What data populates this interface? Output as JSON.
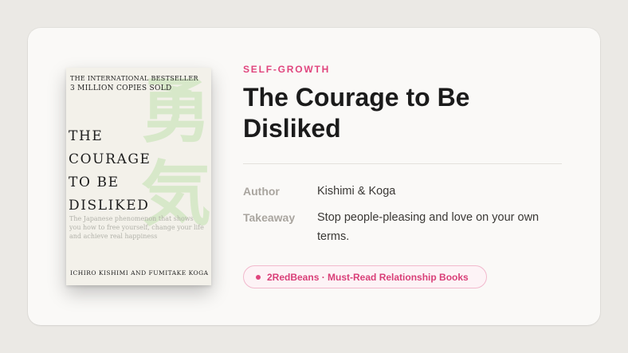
{
  "book": {
    "cover": {
      "top_line_1": "THE INTERNATIONAL BESTSELLER",
      "top_line_2": "3 MILLION COPIES SOLD",
      "kanji": "勇気",
      "title_lines": [
        "THE",
        "COURAGE",
        "TO BE",
        "DISLIKED"
      ],
      "blurb": "The Japanese phenomenon that shows you how to free yourself, change your life and achieve real happiness",
      "authors": "ICHIRO KISHIMI AND FUMITAKE KOGA"
    },
    "category": "SELF-GROWTH",
    "title": "The Courage to Be Disliked",
    "details": {
      "author_label": "Author",
      "author_value": "Kishimi & Koga",
      "takeaway_label": "Takeaway",
      "takeaway_value": "Stop people-pleasing and love on your own terms."
    },
    "badge": {
      "text": "2RedBeans · Must-Read Relationship Books"
    }
  },
  "colors": {
    "accent": "#e0457e",
    "background": "#ebe9e5",
    "card": "#faf9f7",
    "kanji": "#d7e8c9"
  }
}
